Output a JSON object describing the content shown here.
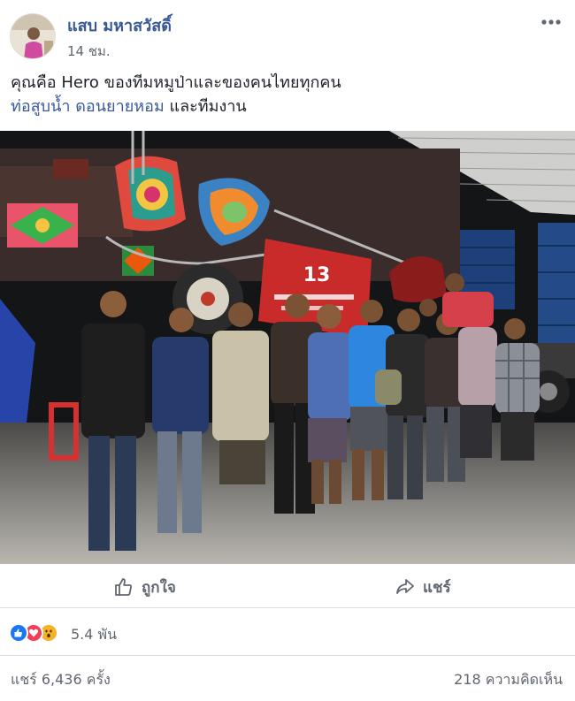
{
  "post": {
    "author": "แสบ มหาสวัสดิ์",
    "time": "14 ชม.",
    "text_line1": "คุณคือ Hero ของทีมหมูป่าและของคนไทยทุกคน",
    "link1": "ท่อสูบน้ำ",
    "link2": "ดอนยายหอม",
    "text_tail": " และทีมงาน",
    "banner_text": "13"
  },
  "actions": {
    "like_label": "ถูกใจ",
    "share_label": "แชร์"
  },
  "reactions": {
    "icons": [
      "like-icon",
      "love-icon",
      "wow-icon"
    ],
    "count": "5.4 พัน"
  },
  "stats": {
    "shares": "แชร์ 6,436 ครั้ง",
    "comments": "218 ความคิดเห็น"
  },
  "colors": {
    "link": "#385898",
    "muted": "#616770",
    "like_blue": "#1877f2",
    "love_red": "#f33e58",
    "wow_yellow": "#f7b125",
    "divider": "#dadde1"
  }
}
